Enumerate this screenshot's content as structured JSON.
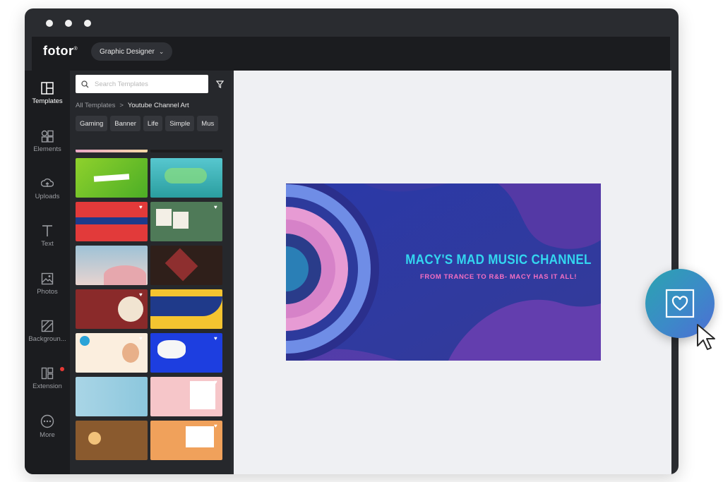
{
  "app": {
    "logo": "fotor",
    "logo_mark": "®",
    "mode_button": "Graphic Designer"
  },
  "rail": [
    {
      "id": "templates",
      "label": "Templates",
      "active": true
    },
    {
      "id": "elements",
      "label": "Elements"
    },
    {
      "id": "uploads",
      "label": "Uploads"
    },
    {
      "id": "text",
      "label": "Text"
    },
    {
      "id": "photos",
      "label": "Photos"
    },
    {
      "id": "background",
      "label": "Backgroun..."
    },
    {
      "id": "extension",
      "label": "Extension",
      "badge": true
    },
    {
      "id": "more",
      "label": "More"
    }
  ],
  "panel": {
    "search_placeholder": "Search Templates",
    "breadcrumb_root": "All Templates",
    "breadcrumb_sep": ">",
    "breadcrumb_current": "Youtube Channel Art",
    "chips": [
      "Gaming",
      "Banner",
      "Life",
      "Simple",
      "Mus"
    ]
  },
  "canvas": {
    "title": "MACY'S MAD MUSIC CHANNEL",
    "subtitle": "FROM TRANCE TO R&B- MACY HAS IT ALL!"
  },
  "colors": {
    "accent_cyan": "#33d6f0",
    "accent_pink": "#f36fc2",
    "banner_blue": "#2f3a9a",
    "extension_badge": "#e53935"
  }
}
